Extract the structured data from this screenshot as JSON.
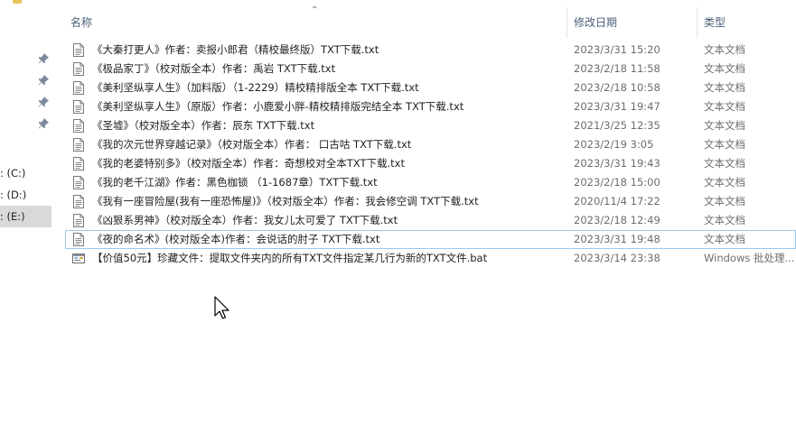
{
  "nav": {
    "drives": [
      {
        "label": ": (C:)"
      },
      {
        "label": ": (D:)"
      },
      {
        "label": ": (E:)",
        "selected": true
      }
    ]
  },
  "header": {
    "name": "名称",
    "date": "修改日期",
    "type": "类型"
  },
  "files": [
    {
      "name": "《大秦打更人》作者：卖报小郎君（精校最终版）TXT下载.txt",
      "date": "2023/3/31 15:20",
      "type": "文本文档",
      "icon": "text-file-icon"
    },
    {
      "name": "《极品家丁》（校对版全本）作者：禹岩 TXT下载.txt",
      "date": "2023/2/18 11:58",
      "type": "文本文档",
      "icon": "text-file-icon"
    },
    {
      "name": "《美利坚纵享人生》（加料版）（1-2229）精校精排版全本 TXT下载.txt",
      "date": "2023/2/18 10:58",
      "type": "文本文档",
      "icon": "text-file-icon"
    },
    {
      "name": "《美利坚纵享人生》（原版）作者：小鹿爱小胖-精校精排版完结全本 TXT下载.txt",
      "date": "2023/3/31 19:47",
      "type": "文本文档",
      "icon": "text-file-icon"
    },
    {
      "name": "《圣墟》（校对版全本）作者：辰东 TXT下载.txt",
      "date": "2021/3/25 12:35",
      "type": "文本文档",
      "icon": "text-file-icon"
    },
    {
      "name": "《我的次元世界穿越记录》（校对版全本）作者： 口古咕 TXT下载.txt",
      "date": "2023/2/19 3:05",
      "type": "文本文档",
      "icon": "text-file-icon"
    },
    {
      "name": "《我的老婆特别多》（校对版全本）作者：奇想校对全本TXT下载.txt",
      "date": "2023/3/31 19:43",
      "type": "文本文档",
      "icon": "text-file-icon"
    },
    {
      "name": "《我的老千江湖》作者：黑色枷锁 （1-1687章）TXT下载.txt",
      "date": "2023/2/18 15:00",
      "type": "文本文档",
      "icon": "text-file-icon"
    },
    {
      "name": "《我有一座冒险屋(我有一座恐怖屋)》（校对版全本）作者：我会修空调 TXT下载.txt",
      "date": "2020/11/4 17:22",
      "type": "文本文档",
      "icon": "text-file-icon"
    },
    {
      "name": "《凶狠系男神》（校对版全本）作者：我女儿太可爱了 TXT下载.txt",
      "date": "2023/2/18 12:49",
      "type": "文本文档",
      "icon": "text-file-icon"
    },
    {
      "name": "《夜的命名术》(校对版全本)作者：会说话的肘子 TXT下载.txt",
      "date": "2023/3/31 19:48",
      "type": "文本文档",
      "icon": "text-file-icon",
      "focused": true
    },
    {
      "name": "【价值50元】珍藏文件：提取文件夹内的所有TXT文件指定某几行为新的TXT文件.bat",
      "date": "2023/3/14 23:38",
      "type": "Windows 批处理...",
      "icon": "batch-file-icon"
    }
  ]
}
